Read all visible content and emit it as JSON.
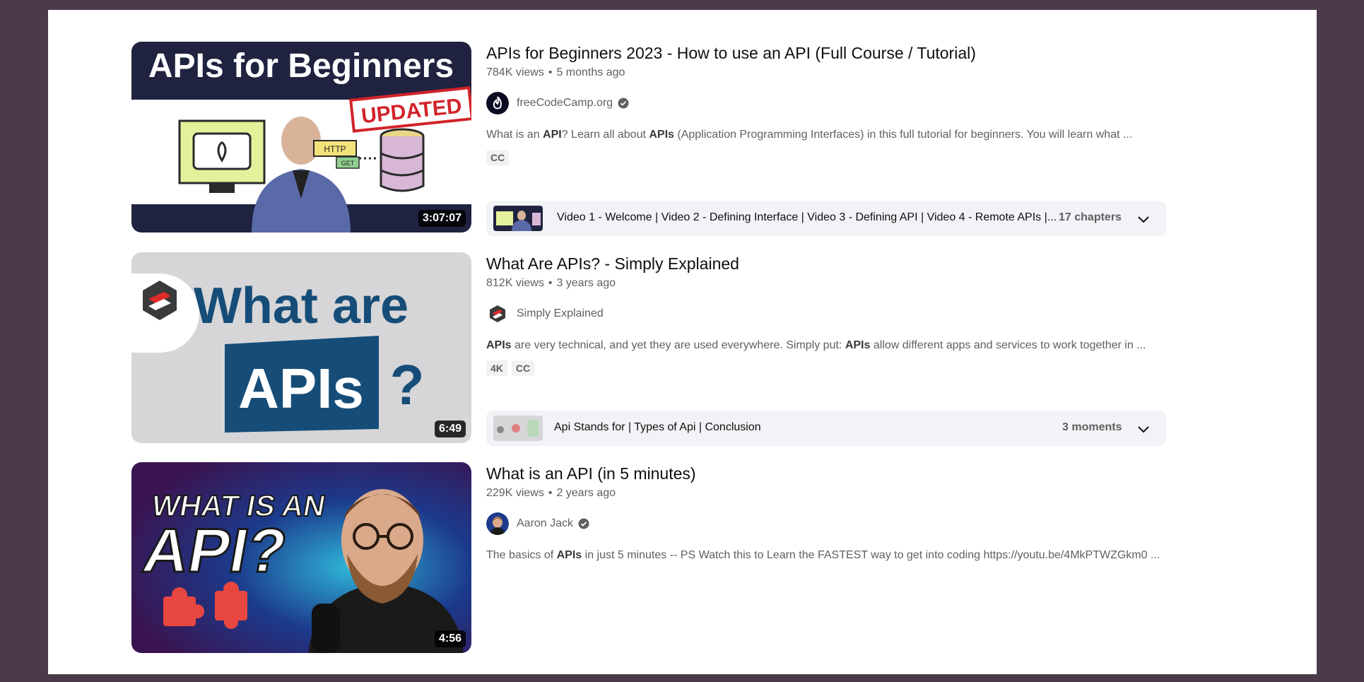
{
  "results": [
    {
      "thumb_text": [
        "APIs for Beginners",
        "UPDATED",
        "HTTP",
        "GET"
      ],
      "duration": "3:07:07",
      "title": "APIs for Beginners 2023 - How to use an API (Full Course / Tutorial)",
      "views": "784K views",
      "age": "5 months ago",
      "channel": "freeCodeCamp.org",
      "verified": true,
      "description_parts": [
        {
          "t": "What is an ",
          "b": false
        },
        {
          "t": "API",
          "b": true
        },
        {
          "t": "? Learn all about ",
          "b": false
        },
        {
          "t": "APIs",
          "b": true
        },
        {
          "t": " (Application Programming Interfaces) in this full tutorial for beginners. You will learn what ...",
          "b": false
        }
      ],
      "badges": [
        "CC"
      ],
      "chapters_text": "Video 1 - Welcome |  Video 2 - Defining Interface |  Video 3 - Defining API |  Video 4 - Remote APIs |...",
      "chapters_count": "17 chapters"
    },
    {
      "thumb_text": [
        "What are",
        "APIs",
        "?"
      ],
      "duration": "6:49",
      "title": "What Are APIs? - Simply Explained",
      "views": "812K views",
      "age": "3 years ago",
      "channel": "Simply Explained",
      "verified": false,
      "description_parts": [
        {
          "t": "APIs",
          "b": true
        },
        {
          "t": " are very technical, and yet they are used everywhere. Simply put: ",
          "b": false
        },
        {
          "t": "APIs",
          "b": true
        },
        {
          "t": " allow different apps and services to work together in ...",
          "b": false
        }
      ],
      "badges": [
        "4K",
        "CC"
      ],
      "chapters_text": "Api Stands for | Types of Api | Conclusion",
      "chapters_count": "3 moments"
    },
    {
      "thumb_text": [
        "WHAT IS AN",
        "API?"
      ],
      "duration": "4:56",
      "title": "What is an API (in 5 minutes)",
      "views": "229K views",
      "age": "2 years ago",
      "channel": "Aaron Jack",
      "verified": true,
      "description_parts": [
        {
          "t": "The basics of ",
          "b": false
        },
        {
          "t": "APIs",
          "b": true
        },
        {
          "t": " in just 5 minutes -- PS Watch this to Learn the FASTEST way to get into coding https://youtu.be/4MkPTWZGkm0 ...",
          "b": false
        }
      ],
      "badges": []
    }
  ],
  "separator": "•",
  "colors": {
    "backdrop": "#4b3a4a",
    "page": "#ffffff",
    "chapter_bar": "#f1f3f6",
    "meta_text": "#606060"
  },
  "icons": [
    "verified-check-icon",
    "chevron-down-icon",
    "fire-icon",
    "simply-explained-logo-icon"
  ]
}
